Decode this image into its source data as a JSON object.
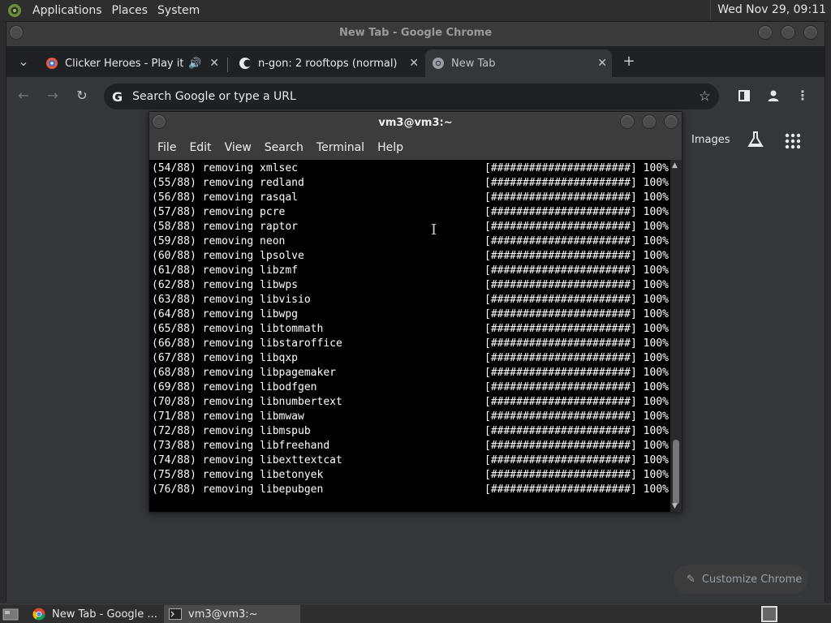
{
  "top_panel": {
    "menus": [
      "Applications",
      "Places",
      "System"
    ],
    "clock": "Wed Nov 29, 09:11"
  },
  "chrome": {
    "window_title": "New Tab - Google Chrome",
    "tabs": [
      {
        "title": "Clicker Heroes - Play it no"
      },
      {
        "title": "n-gon: 2 rooftops (normal)"
      },
      {
        "title": "New Tab"
      }
    ],
    "omnibox_placeholder": "Search Google or type a URL",
    "ntp": {
      "images_label": "Images",
      "customize_label": "Customize Chrome"
    }
  },
  "terminal": {
    "title": "vm3@vm3:~",
    "menu": [
      "File",
      "Edit",
      "View",
      "Search",
      "Terminal",
      "Help"
    ],
    "progress_bar": "[######################]",
    "progress_pct": "100%",
    "lines": [
      "(54/88) removing xmlsec",
      "(55/88) removing redland",
      "(56/88) removing rasqal",
      "(57/88) removing pcre",
      "(58/88) removing raptor",
      "(59/88) removing neon",
      "(60/88) removing lpsolve",
      "(61/88) removing libzmf",
      "(62/88) removing libwps",
      "(63/88) removing libvisio",
      "(64/88) removing libwpg",
      "(65/88) removing libtommath",
      "(66/88) removing libstaroffice",
      "(67/88) removing libqxp",
      "(68/88) removing libpagemaker",
      "(69/88) removing libodfgen",
      "(70/88) removing libnumbertext",
      "(71/88) removing libmwaw",
      "(72/88) removing libmspub",
      "(73/88) removing libfreehand",
      "(74/88) removing libexttextcat",
      "(75/88) removing libetonyek",
      "(76/88) removing libepubgen"
    ]
  },
  "taskbar": {
    "items": [
      {
        "label": "New Tab - Google ..."
      },
      {
        "label": "vm3@vm3:~"
      }
    ]
  }
}
